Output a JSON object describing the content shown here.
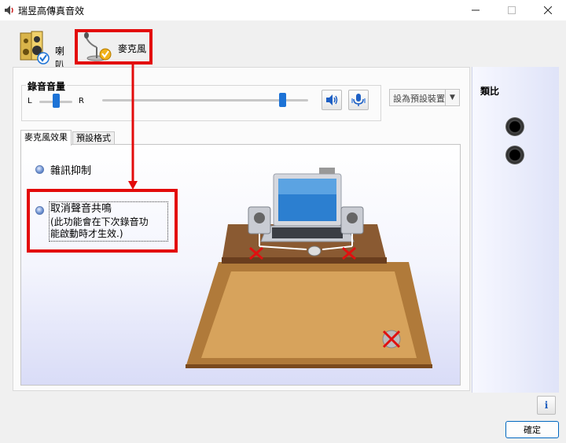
{
  "window": {
    "title": "瑞昱高傳真音效"
  },
  "devices": [
    {
      "label": "喇叭",
      "icon": "speaker-icon"
    },
    {
      "label": "麥克風",
      "icon": "microphone-icon",
      "selected": true
    }
  ],
  "recording": {
    "group_title": "錄音音量",
    "left_label": "L",
    "right_label": "R",
    "volume_level": 0.87,
    "balance_level": 0.5
  },
  "default_device": {
    "label": "設為預設裝置"
  },
  "tabs": [
    {
      "label": "麥克風效果",
      "active": true
    },
    {
      "label": "預設格式",
      "active": false
    }
  ],
  "effects": {
    "noise_suppression": "雜訊抑制",
    "echo_cancel": "取消聲音共鳴",
    "echo_note_line1": "(此功能會在下次錄音功",
    "echo_note_line2": "能啟動時才生效.)"
  },
  "analog": {
    "title": "類比"
  },
  "buttons": {
    "ok": "確定",
    "info": "i"
  },
  "colors": {
    "accent": "#1d73d6",
    "highlight": "#e30b0b"
  }
}
